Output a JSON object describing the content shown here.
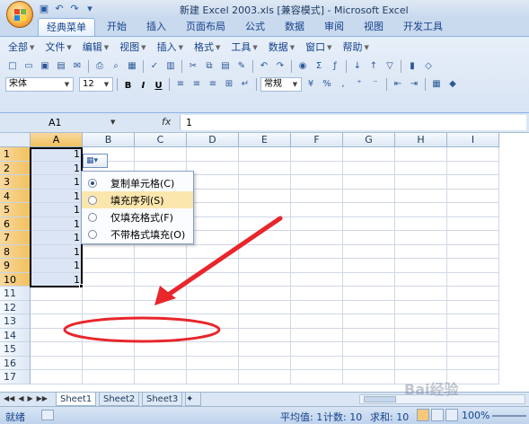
{
  "title_bar": {
    "title": "新建 Excel 2003.xls  [兼容模式] - Microsoft Excel"
  },
  "tabs": [
    "经典菜单",
    "开始",
    "插入",
    "页面布局",
    "公式",
    "数据",
    "审阅",
    "视图",
    "开发工具"
  ],
  "menu": [
    "全部",
    "文件",
    "编辑",
    "视图",
    "插入",
    "格式",
    "工具",
    "数据",
    "窗口",
    "帮助"
  ],
  "toolbar": {
    "font_name": "宋体",
    "font_size": "12",
    "bold": "B",
    "italic": "I",
    "underline": "U",
    "number_format": "常规"
  },
  "formula_bar": {
    "name_box": "A1",
    "fx": "fx",
    "formula": "1"
  },
  "columns": [
    "A",
    "B",
    "C",
    "D",
    "E",
    "F",
    "G",
    "H",
    "I"
  ],
  "rows": [
    {
      "num": "1",
      "a": "1"
    },
    {
      "num": "2",
      "a": "1"
    },
    {
      "num": "3",
      "a": "1"
    },
    {
      "num": "4",
      "a": "1"
    },
    {
      "num": "5",
      "a": "1"
    },
    {
      "num": "6",
      "a": "1"
    },
    {
      "num": "7",
      "a": "1"
    },
    {
      "num": "8",
      "a": "1"
    },
    {
      "num": "9",
      "a": "1"
    },
    {
      "num": "10",
      "a": "1"
    },
    {
      "num": "11",
      "a": ""
    },
    {
      "num": "12",
      "a": ""
    },
    {
      "num": "13",
      "a": ""
    },
    {
      "num": "14",
      "a": ""
    },
    {
      "num": "15",
      "a": ""
    },
    {
      "num": "16",
      "a": ""
    },
    {
      "num": "17",
      "a": ""
    }
  ],
  "autofill_menu": {
    "items": [
      "复制单元格(C)",
      "填充序列(S)",
      "仅填充格式(F)",
      "不带格式填充(O)"
    ],
    "selected_index": 0,
    "highlighted_index": 1
  },
  "sheets": [
    "Sheet1",
    "Sheet2",
    "Sheet3"
  ],
  "status": {
    "ready": "就绪",
    "average": "平均值: 1",
    "count": "计数: 10",
    "sum": "求和: 10",
    "zoom": "100%"
  },
  "watermark": "Bai经验",
  "colors": {
    "annotation": "#e8262b",
    "selection_header": "#f6c879",
    "ribbon": "#dbe6f4"
  }
}
